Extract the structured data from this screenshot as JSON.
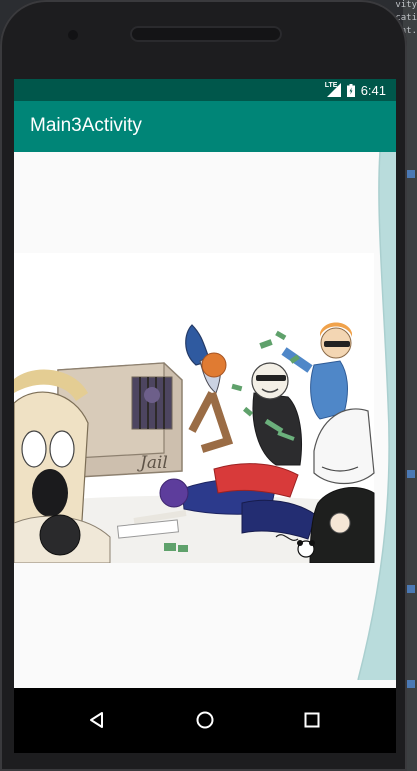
{
  "ide": {
    "fragments": [
      "vity",
      "cati",
      "nt."
    ]
  },
  "status_bar": {
    "network": "LTE",
    "time": "6:41",
    "icons": [
      "lte-signal-icon",
      "battery-icon"
    ]
  },
  "app_bar": {
    "title": "Main3Activity"
  },
  "artwork": {
    "jail_label": "Jail",
    "colors": {
      "status_bar": "#00574b",
      "app_bar": "#008577",
      "overlay": "#b9dcdc"
    }
  },
  "navigation": {
    "buttons": [
      "back-icon",
      "home-icon",
      "recents-icon"
    ]
  }
}
